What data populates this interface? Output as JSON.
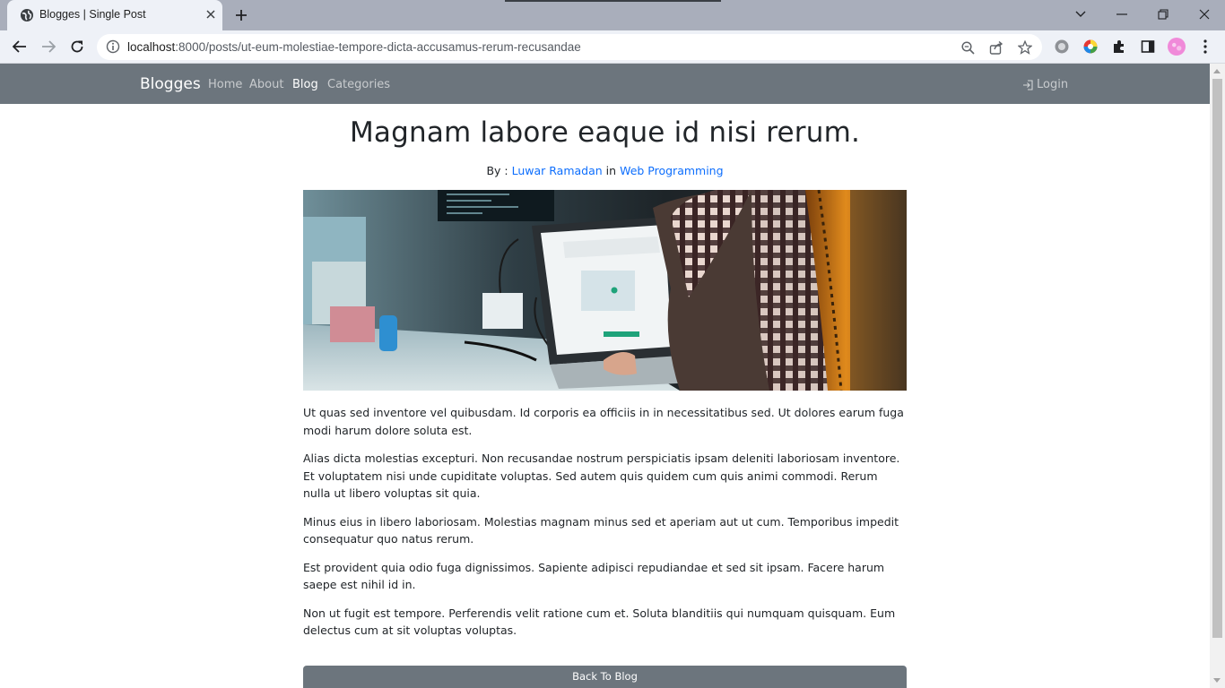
{
  "browser": {
    "tab_title": "Blogges | Single Post",
    "url_host": "localhost",
    "url_rest": ":8000/posts/ut-eum-molestiae-tempore-dicta-accusamus-rerum-recusandae"
  },
  "navbar": {
    "brand": "Blogges",
    "links": [
      "Home",
      "About",
      "Blog",
      "Categories"
    ],
    "active": "Blog",
    "login": "Login"
  },
  "post": {
    "title": "Magnam labore eaque id nisi rerum.",
    "by_label": "By :",
    "author": "Luwar Ramadan",
    "in_label": "in",
    "category": "Web Programming",
    "paragraphs": [
      "Ut quas sed inventore vel quibusdam. Id corporis ea officiis in in necessitatibus sed. Ut dolores earum fuga modi harum dolore soluta est.",
      "Alias dicta molestias excepturi. Non recusandae nostrum perspiciatis ipsam deleniti laboriosam inventore. Et voluptatem nisi unde cupiditate voluptas. Sed autem quis quidem cum quis animi commodi. Rerum nulla ut libero voluptas sit quia.",
      "Minus eius in libero laboriosam. Molestias magnam minus sed et aperiam aut ut cum. Temporibus impedit consequatur quo natus rerum.",
      "Est provident quia odio fuga dignissimos. Sapiente adipisci repudiandae et sed sit ipsam. Facere harum saepe est nihil id in.",
      "Non ut fugit est tempore. Perferendis velit ratione cum et. Soluta blanditiis qui numquam quisquam. Eum delectus cum at sit voluptas voluptas."
    ],
    "back_button": "Back To Blog"
  },
  "colors": {
    "navbar": "#6c757d",
    "link": "#0d6efd",
    "button": "#6c757d"
  }
}
